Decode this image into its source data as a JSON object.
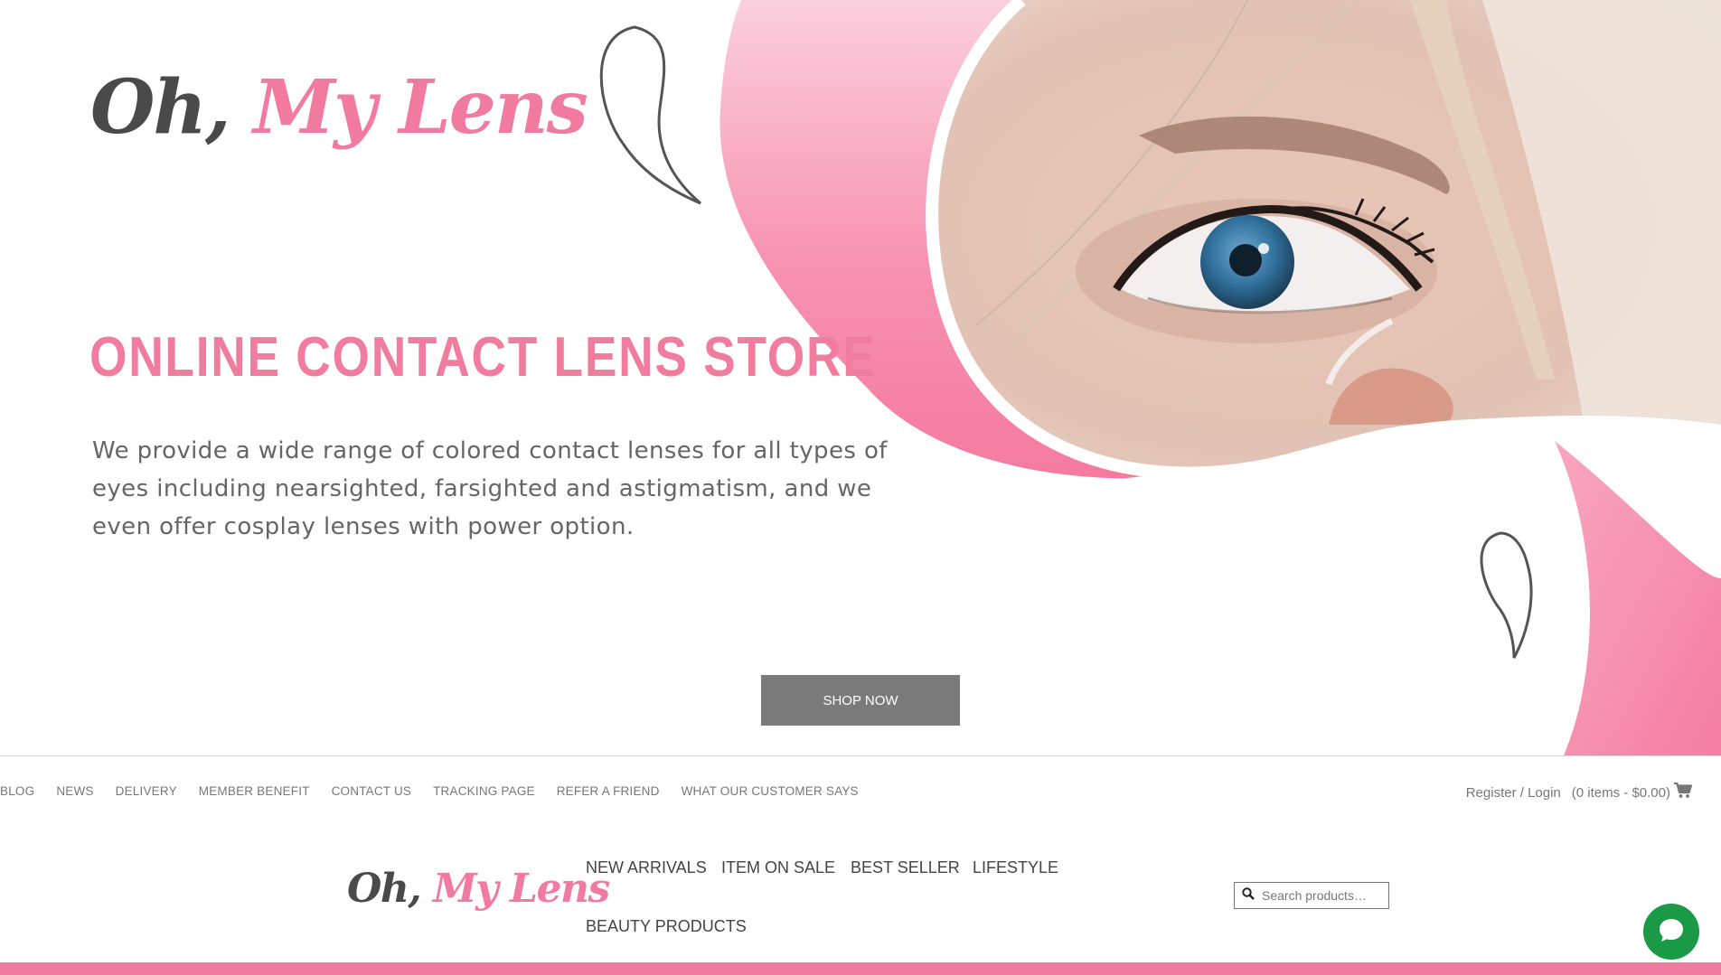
{
  "hero": {
    "logo_part1": "Oh,",
    "logo_part2": "My Lens",
    "heading": "ONLINE CONTACT LENS STORE",
    "description": "We provide a wide range of colored contact lenses for all types of eyes including nearsighted, farsighted and astigmatism, and we even offer cosplay lenses with power option.",
    "cta_label": "SHOP NOW"
  },
  "top_nav": {
    "items": [
      "BLOG",
      "NEWS",
      "DELIVERY",
      "MEMBER BENEFIT",
      "CONTACT US",
      "TRACKING PAGE",
      "REFER A FRIEND",
      "WHAT OUR CUSTOMER SAYS"
    ]
  },
  "account": {
    "login_label": "Register / Login",
    "cart_label": "(0 items - $0.00)",
    "cart_icon": "shopping-cart-icon"
  },
  "main_nav": {
    "logo_part1": "Oh,",
    "logo_part2": "My Lens",
    "items": [
      "NEW ARRIVALS",
      "ITEM ON SALE",
      "BEST SELLER",
      "LIFESTYLE",
      "BEAUTY PRODUCTS"
    ]
  },
  "search": {
    "placeholder": "Search products…",
    "icon": "search-icon"
  },
  "chat": {
    "icon": "chat-bubble-icon"
  },
  "colors": {
    "brand_pink": "#f07c9f",
    "dark_text": "#4a4a4a",
    "button_gray": "#7a7a7a",
    "chat_green": "#1a9946"
  }
}
